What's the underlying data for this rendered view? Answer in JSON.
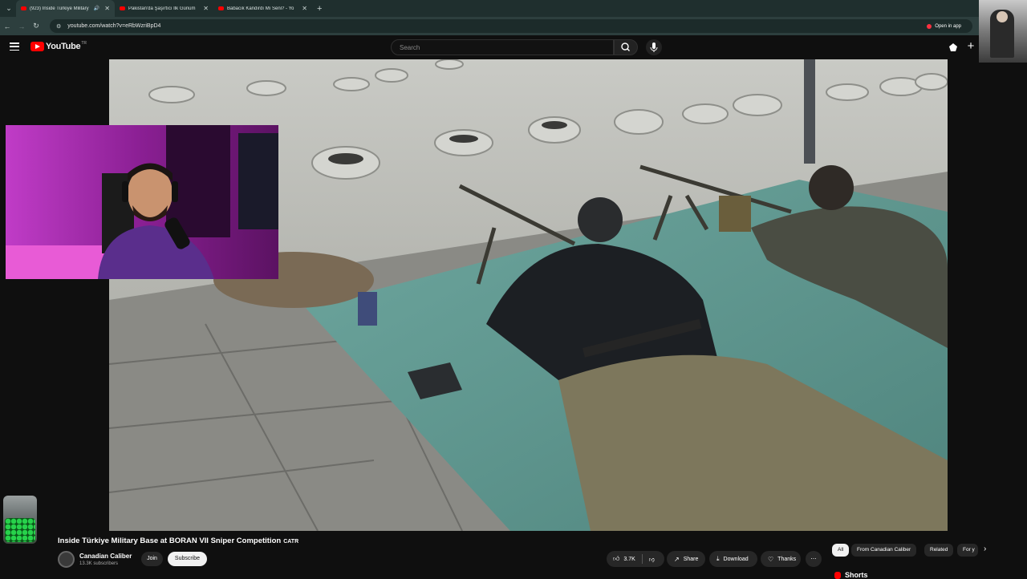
{
  "browser": {
    "tabs": [
      {
        "title": "(923) Inside Türkiye Military",
        "active": true
      },
      {
        "title": "Pakistan'da Şaşırtıcı İlk Günüm",
        "active": false
      },
      {
        "title": "Babacık Kandırdı Mı Seni? - Yo",
        "active": false
      }
    ],
    "url": "youtube.com/watch?v=eRbWzriBpD4",
    "open_in_app": "Open in app"
  },
  "youtube": {
    "logo_text": "YouTube",
    "region": "TR",
    "search_placeholder": "Search"
  },
  "video": {
    "title": "Inside Türkiye Military Base at BORAN VII Sniper Competition",
    "title_badge": "CATR",
    "channel": "Canadian Caliber",
    "subscribers": "13.3K subscribers",
    "join_label": "Join",
    "subscribe_label": "Subscribe",
    "like_count": "3.7K",
    "share_label": "Share",
    "download_label": "Download",
    "thanks_label": "Thanks"
  },
  "sidebar": {
    "chips": [
      "All",
      "From Canadian Caliber",
      "Related",
      "For y"
    ],
    "shorts_label": "Shorts"
  },
  "colors": {
    "accent": "#ff0000",
    "browser_chrome": "#2d3f3e",
    "page_bg": "#0f0f0f"
  }
}
